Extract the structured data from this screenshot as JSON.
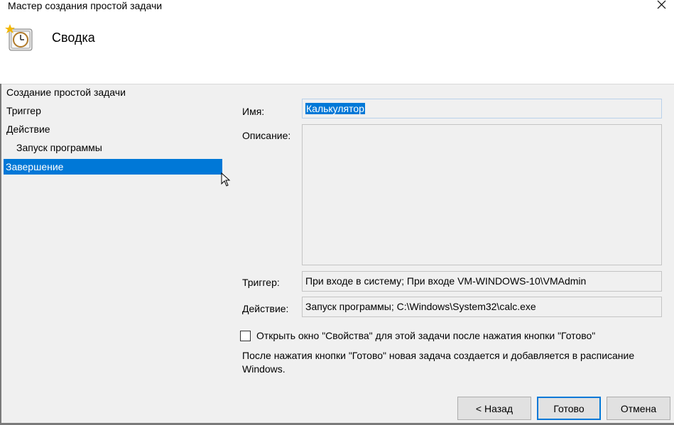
{
  "window": {
    "title": "Мастер создания простой задачи"
  },
  "header": {
    "title": "Сводка"
  },
  "steps": [
    {
      "label": "Создание простой задачи"
    },
    {
      "label": "Триггер"
    },
    {
      "label": "Действие"
    },
    {
      "label": "Запуск программы"
    },
    {
      "label": "Завершение"
    }
  ],
  "form": {
    "name_label": "Имя:",
    "name_value": "Калькулятор",
    "description_label": "Описание:",
    "description_value": "",
    "trigger_label": "Триггер:",
    "trigger_value": "При входе в систему; При входе VM-WINDOWS-10\\VMAdmin",
    "action_label": "Действие:",
    "action_value": "Запуск программы; C:\\Windows\\System32\\calc.exe",
    "open_properties_label": "Открыть окно \"Свойства\" для этой задачи после нажатия кнопки \"Готово\"",
    "open_properties_checked": false,
    "note": "После нажатия кнопки \"Готово\" новая задача создается и добавляется в расписание Windows."
  },
  "buttons": {
    "back": "< Назад",
    "finish": "Готово",
    "cancel": "Отмена"
  },
  "colors": {
    "accent": "#0078d7",
    "background": "#f0f0f0"
  },
  "icons": [
    "close-icon",
    "task-scheduler-wizard-icon",
    "mouse-cursor-icon"
  ]
}
